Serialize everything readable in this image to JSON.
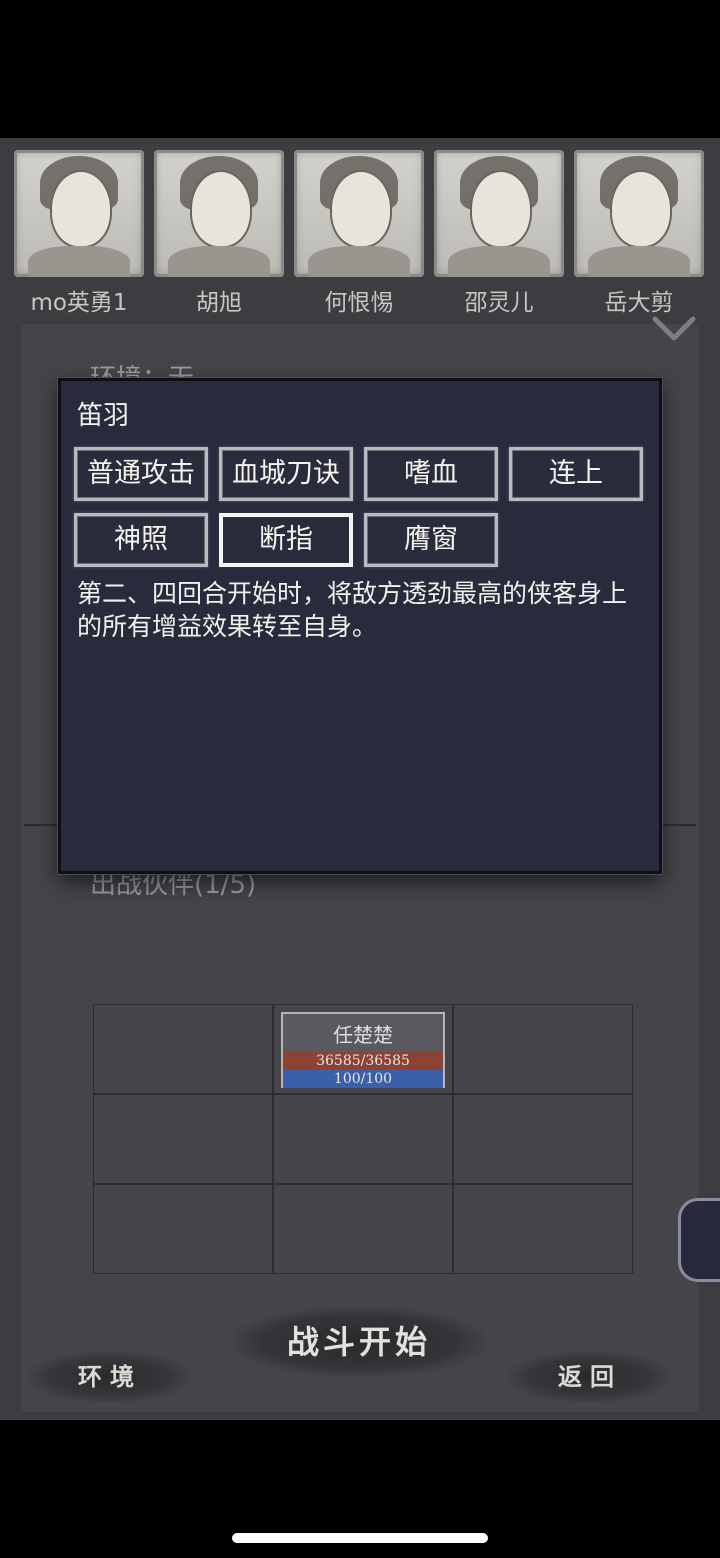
{
  "portraits": [
    {
      "name": "mo英勇1"
    },
    {
      "name": "胡旭"
    },
    {
      "name": "何恨惕"
    },
    {
      "name": "邵灵儿"
    },
    {
      "name": "岳大剪"
    }
  ],
  "environment_label": "环境：无",
  "partners_label": "出战伙伴(1/5)",
  "formation": {
    "unit": {
      "name": "任楚楚",
      "hp_text": "36585/36585",
      "mp_text": "100/100",
      "hp_fraction": 1.0,
      "mp_fraction": 1.0
    }
  },
  "dialog": {
    "title": "笛羽",
    "skills": [
      "普通攻击",
      "血城刀诀",
      "嗜血",
      "连上",
      "神照",
      "断指",
      "膺窗"
    ],
    "selected_skill": "断指",
    "description": "第二、四回合开始时，将敌方透劲最高的侠客身上的所有增益效果转至自身。"
  },
  "buttons": {
    "start": "战斗开始",
    "environment": "环境",
    "back": "返回"
  },
  "colors": {
    "hp_bar": "#8c4335",
    "mp_bar": "#3c5fa9",
    "dialog_bg": "#282b3b"
  }
}
